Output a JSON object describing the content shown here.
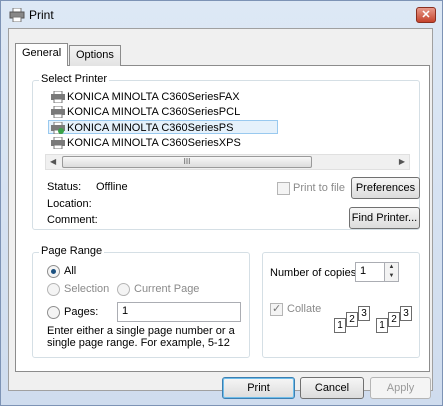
{
  "window": {
    "title": "Print",
    "close_label": "✕"
  },
  "tabs": [
    {
      "label": "General"
    },
    {
      "label": "Options"
    }
  ],
  "select_printer": {
    "group_label": "Select Printer",
    "printers": [
      {
        "label": "KONICA MINOLTA C360SeriesFAX"
      },
      {
        "label": "KONICA MINOLTA C360SeriesPCL"
      },
      {
        "label": "KONICA MINOLTA C360SeriesPS"
      },
      {
        "label": "KONICA MINOLTA C360SeriesXPS"
      }
    ],
    "scroll_thumb": "III",
    "status_label": "Status:",
    "status_value": "Offline",
    "location_label": "Location:",
    "comment_label": "Comment:",
    "print_to_file_label": "Print to file",
    "preferences_label": "Preferences",
    "find_printer_label": "Find Printer..."
  },
  "page_range": {
    "group_label": "Page Range",
    "all_label": "All",
    "selection_label": "Selection",
    "current_page_label": "Current Page",
    "pages_label": "Pages:",
    "pages_value": "1",
    "hint": "Enter either a single page number or a single page range.  For example, 5-12"
  },
  "copies": {
    "label": "Number of copies:",
    "value": "1",
    "collate_label": "Collate",
    "collate_digits": [
      "1",
      "2",
      "3"
    ]
  },
  "footer": {
    "print_label": "Print",
    "cancel_label": "Cancel",
    "apply_label": "Apply"
  }
}
